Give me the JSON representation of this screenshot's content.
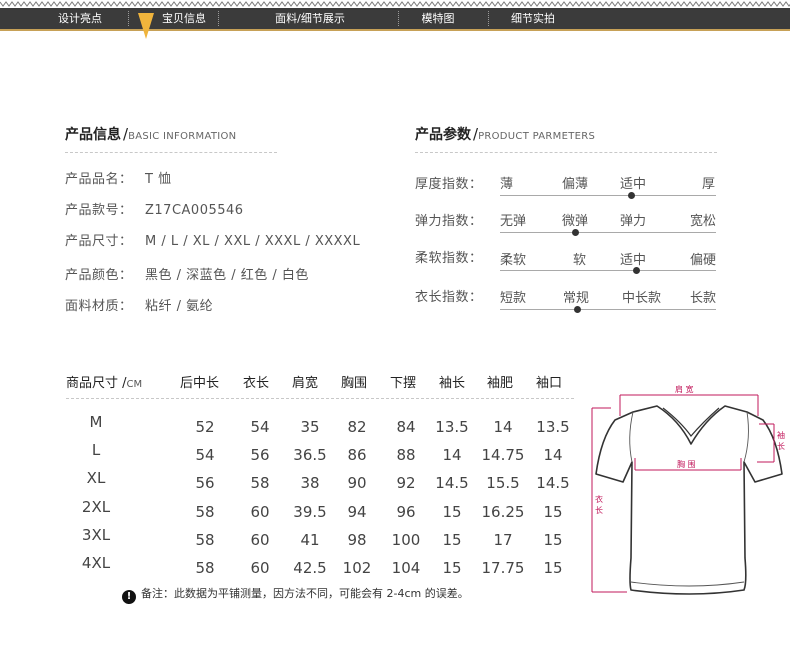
{
  "nav": {
    "items": [
      "设计亮点",
      "宝贝信息",
      "面料/细节展示",
      "模特图",
      "细节实拍"
    ],
    "accent": "#f0b43c",
    "bar_color": "#3b3b3b"
  },
  "product_info": {
    "title_cn": "产品信息",
    "slash": "/",
    "title_en": "BASIC INFORMATION",
    "rows": [
      {
        "key": "产品品名：",
        "value": "T 恤"
      },
      {
        "key": "产品款号：",
        "value": "Z17CA005546"
      },
      {
        "key": "产品尺寸：",
        "value": "M / L / XL / XXL / XXXL / XXXXL"
      },
      {
        "key": "产品颜色：",
        "value": "黑色 / 深蓝色 / 红色 / 白色"
      },
      {
        "key": "面料材质：",
        "value": "粘纤 / 氨纶"
      }
    ]
  },
  "parameters": {
    "title_cn": "产品参数",
    "slash": "/",
    "title_en": "PRODUCT PARMETERS",
    "rows": [
      {
        "label": "厚度指数：",
        "options": [
          "薄",
          "偏薄",
          "适中",
          "厚"
        ],
        "level": 0.61
      },
      {
        "label": "弹力指数：",
        "options": [
          "无弹",
          "微弹",
          "弹力",
          "宽松"
        ],
        "level": 0.35
      },
      {
        "label": "柔软指数：",
        "options": [
          "柔软",
          "软",
          "适中",
          "偏硬"
        ],
        "level": 0.63
      },
      {
        "label": "衣长指数：",
        "options": [
          "短款",
          "常规",
          "中长款",
          "长款"
        ],
        "level": 0.36
      }
    ]
  },
  "size_table": {
    "header": {
      "label": "商品尺寸 /",
      "unit": "CM"
    },
    "columns": [
      "后中长",
      "衣长",
      "肩宽",
      "胸围",
      "下摆",
      "袖长",
      "袖肥",
      "袖口"
    ],
    "rows": [
      {
        "size": "M",
        "values": [
          "52",
          "54",
          "35",
          "82",
          "84",
          "13.5",
          "14",
          "13.5"
        ]
      },
      {
        "size": "L",
        "values": [
          "54",
          "56",
          "36.5",
          "86",
          "88",
          "14",
          "14.75",
          "14"
        ]
      },
      {
        "size": "XL",
        "values": [
          "56",
          "58",
          "38",
          "90",
          "92",
          "14.5",
          "15.5",
          "14.5"
        ]
      },
      {
        "size": "2XL",
        "values": [
          "58",
          "60",
          "39.5",
          "94",
          "96",
          "15",
          "16.25",
          "15"
        ]
      },
      {
        "size": "3XL",
        "values": [
          "58",
          "60",
          "41",
          "98",
          "100",
          "15",
          "17",
          "15"
        ]
      },
      {
        "size": "4XL",
        "values": [
          "58",
          "60",
          "42.5",
          "102",
          "104",
          "15",
          "17.75",
          "15"
        ]
      }
    ],
    "note_icon": "exclamation-icon",
    "note": "备注：此数据为平铺测量，因方法不同，可能会有 2-4cm 的误差。"
  },
  "diagram": {
    "shoulder_label": "肩 宽",
    "chest_label": "胸 围",
    "length_label": "衣 长",
    "sleeve_label": "袖 长",
    "measure_color": "#c2185b",
    "icon": "tshirt-outline-icon"
  }
}
